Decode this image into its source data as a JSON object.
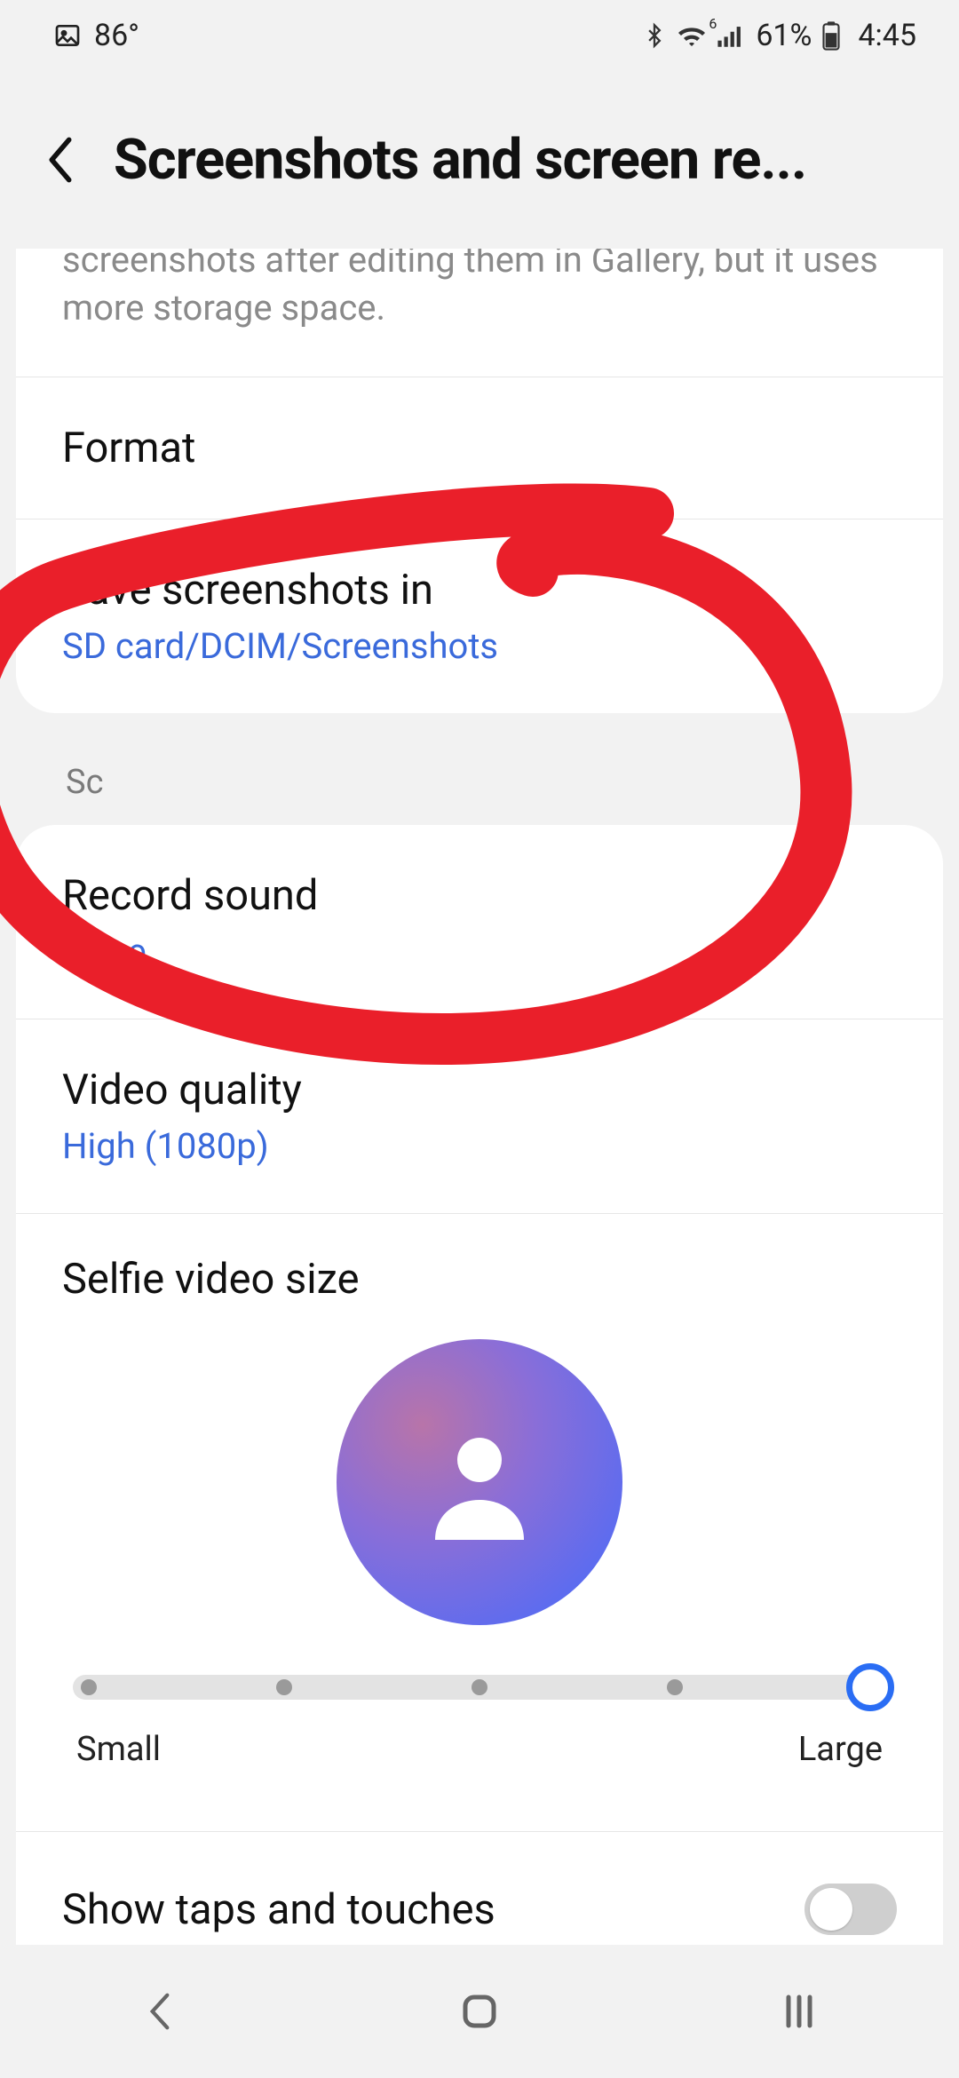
{
  "status": {
    "weather_temp": "86°",
    "battery_pct": "61%",
    "clock": "4:45"
  },
  "header": {
    "title": "Screenshots and screen re..."
  },
  "partial_desc": "screenshots after editing them in Gallery, but it uses more storage space.",
  "rows": {
    "format": {
      "title": "Format"
    },
    "save_in": {
      "title": "Save screenshots in",
      "value": "SD card/DCIM/Screenshots"
    },
    "record_sound": {
      "title": "Record sound",
      "value": "None"
    },
    "video_quality": {
      "title": "Video quality",
      "value": "High (1080p)"
    },
    "selfie": {
      "title": "Selfie video size",
      "min_label": "Small",
      "max_label": "Large"
    },
    "show_taps": {
      "title": "Show taps and touches",
      "on": false
    }
  },
  "section_header_partial": "Sc",
  "slider": {
    "positions": [
      0,
      0.25,
      0.5,
      0.75,
      1.0
    ],
    "value_index": 4
  },
  "colors": {
    "accent": "#2a6df4",
    "link": "#3a6adb",
    "annotation": "#ea1f2a"
  }
}
